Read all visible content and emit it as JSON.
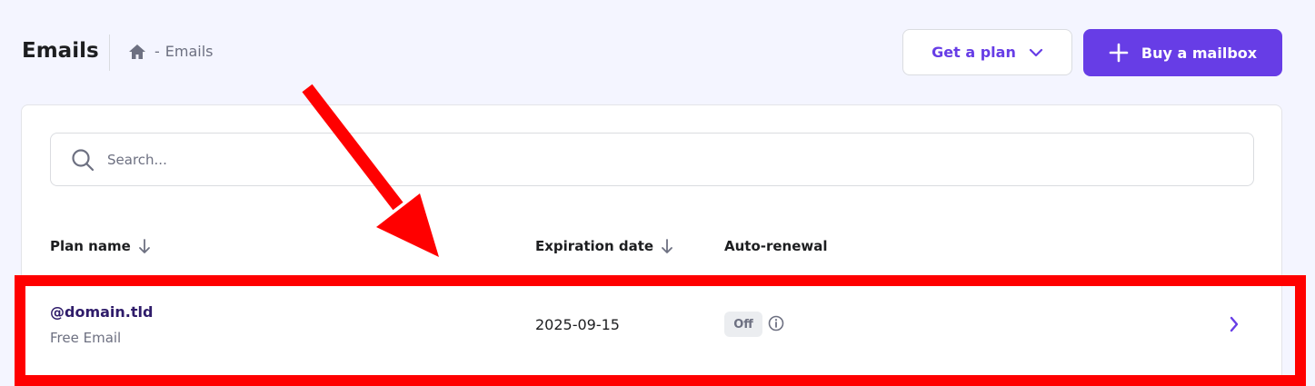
{
  "header": {
    "title": "Emails",
    "breadcrumb": {
      "home_icon": "home-icon",
      "separator": "-",
      "current": "Emails"
    },
    "get_plan_button": "Get a plan",
    "buy_mailbox_button": "Buy a mailbox"
  },
  "search": {
    "placeholder": "Search..."
  },
  "table": {
    "columns": [
      "Plan name",
      "Expiration date",
      "Auto-renewal"
    ],
    "rows": [
      {
        "domain": "@domain.tld",
        "plan": "Free Email",
        "expiration": "2025-09-15",
        "auto_renewal": "Off"
      }
    ]
  },
  "colors": {
    "accent": "#673de6",
    "background": "#f4f5ff",
    "annotation": "#ff0000"
  }
}
